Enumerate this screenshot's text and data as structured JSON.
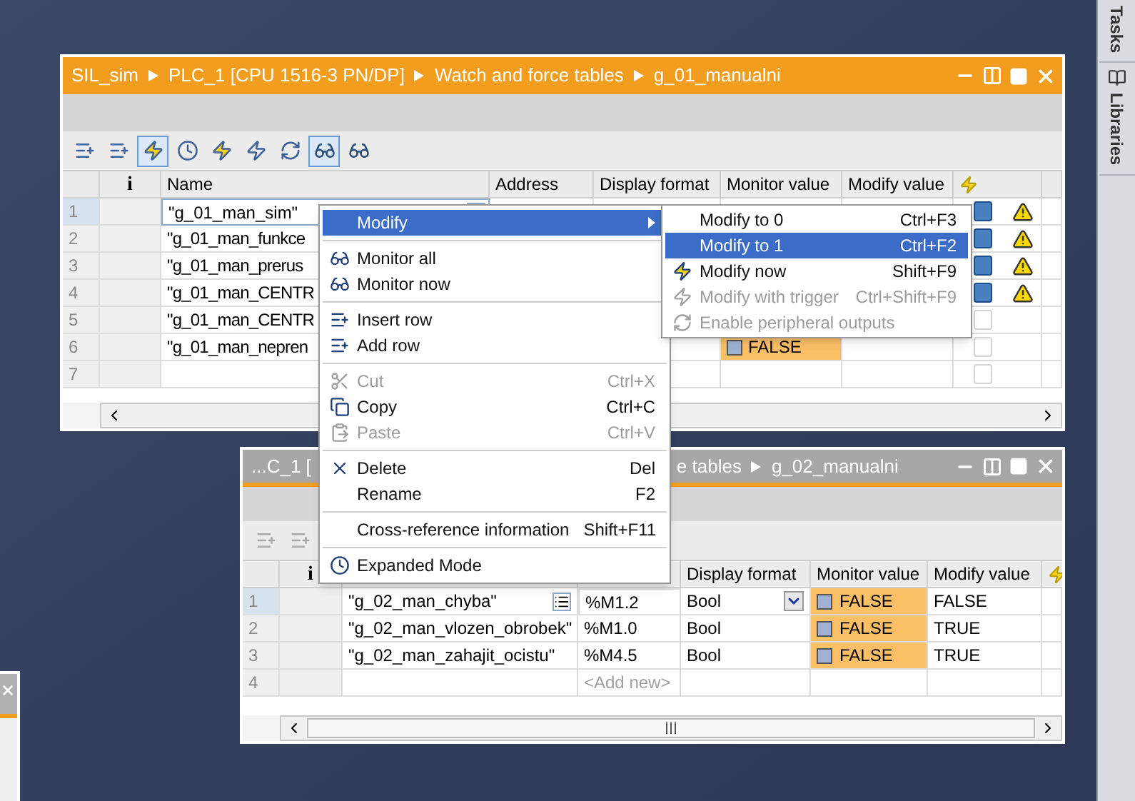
{
  "top_window": {
    "active": true,
    "title_segments": [
      "SIL_sim",
      "PLC_1 [CPU 1516-3 PN/DP]",
      "Watch and force tables",
      "g_01_manualni"
    ],
    "toolbar": [
      {
        "pressed": false
      },
      {
        "pressed": false
      },
      {
        "pressed": true
      },
      {
        "pressed": false
      },
      {
        "pressed": false
      },
      {
        "pressed": false
      },
      {
        "pressed": false
      },
      {
        "pressed": true
      },
      {
        "pressed": false
      }
    ],
    "columns": {
      "info": "i",
      "name": "Name",
      "address": "Address",
      "display_format": "Display format",
      "monitor_value": "Monitor value",
      "modify_value": "Modify value"
    },
    "rows": [
      {
        "number": "1",
        "name": "\"g_01_man_sim\"",
        "selected": true,
        "checked": true
      },
      {
        "number": "2",
        "name": "\"g_01_man_funkce",
        "selected": false,
        "checked": true
      },
      {
        "number": "3",
        "name": "\"g_01_man_prerus",
        "selected": false,
        "checked": true
      },
      {
        "number": "4",
        "name": "\"g_01_man_CENTR",
        "selected": false,
        "checked": true
      },
      {
        "number": "5",
        "name": "\"g_01_man_CENTR",
        "selected": false,
        "checked": false
      },
      {
        "number": "6",
        "name": "\"g_01_man_nepren",
        "selected": false,
        "checked": false,
        "monitor_value": "FALSE"
      },
      {
        "number": "7",
        "selected": false,
        "checked": false
      }
    ]
  },
  "bottom_window": {
    "active": false,
    "title_left": "...C_1 [",
    "title_right": [
      "e tables",
      "g_02_manualni"
    ],
    "toolbar": [
      {
        "disabled": true
      },
      {
        "disabled": true
      }
    ],
    "columns": {
      "info": "i",
      "display_format": "Display format",
      "monitor_value": "Monitor value",
      "modify_value": "Modify value"
    },
    "rows": [
      {
        "number": "1",
        "name": "\"g_02_man_chyba\"",
        "address": "%M1.2",
        "display_format": "Bool",
        "monitor_value": "FALSE",
        "modify_value": "FALSE",
        "selected": true
      },
      {
        "number": "2",
        "name": "\"g_02_man_vlozen_obrobek\"",
        "address": "%M1.0",
        "display_format": "Bool",
        "monitor_value": "FALSE",
        "modify_value": "TRUE",
        "selected": false
      },
      {
        "number": "3",
        "name": "\"g_02_man_zahajit_ocistu\"",
        "address": "%M4.5",
        "display_format": "Bool",
        "monitor_value": "FALSE",
        "modify_value": "TRUE",
        "selected": false
      },
      {
        "number": "4",
        "placeholder": "<Add new>",
        "selected": false
      }
    ]
  },
  "context_menu": [
    {
      "kind": "item",
      "label": "Modify",
      "selected": true,
      "disabled": false,
      "submenu": true
    },
    {
      "kind": "separator"
    },
    {
      "kind": "item",
      "label": "Monitor all",
      "selected": false,
      "disabled": false
    },
    {
      "kind": "item",
      "label": "Monitor now",
      "selected": false,
      "disabled": false
    },
    {
      "kind": "separator"
    },
    {
      "kind": "item",
      "label": "Insert row",
      "selected": false,
      "disabled": false
    },
    {
      "kind": "item",
      "label": "Add row",
      "selected": false,
      "disabled": false
    },
    {
      "kind": "separator"
    },
    {
      "kind": "item",
      "label": "Cut",
      "shortcut": "Ctrl+X",
      "selected": false,
      "disabled": true
    },
    {
      "kind": "item",
      "label": "Copy",
      "shortcut": "Ctrl+C",
      "selected": false,
      "disabled": false
    },
    {
      "kind": "item",
      "label": "Paste",
      "shortcut": "Ctrl+V",
      "selected": false,
      "disabled": true
    },
    {
      "kind": "separator"
    },
    {
      "kind": "item",
      "label": "Delete",
      "shortcut": "Del",
      "selected": false,
      "disabled": false
    },
    {
      "kind": "item",
      "label": "Rename",
      "shortcut": "F2",
      "selected": false,
      "disabled": false
    },
    {
      "kind": "separator"
    },
    {
      "kind": "item",
      "label": "Cross-reference information",
      "shortcut": "Shift+F11",
      "selected": false,
      "disabled": false
    },
    {
      "kind": "separator"
    },
    {
      "kind": "item",
      "label": "Expanded Mode",
      "selected": false,
      "disabled": false
    }
  ],
  "submenu": [
    {
      "label": "Modify to 0",
      "shortcut": "Ctrl+F3",
      "selected": false,
      "disabled": false
    },
    {
      "label": "Modify to 1",
      "shortcut": "Ctrl+F2",
      "selected": true,
      "disabled": false
    },
    {
      "label": "Modify now",
      "shortcut": "Shift+F9",
      "selected": false,
      "disabled": false
    },
    {
      "label": "Modify with trigger",
      "shortcut": "Ctrl+Shift+F9",
      "selected": false,
      "disabled": true
    },
    {
      "label": "Enable peripheral outputs",
      "selected": false,
      "disabled": true
    }
  ],
  "side_tabs": [
    "Tasks",
    "Libraries"
  ]
}
